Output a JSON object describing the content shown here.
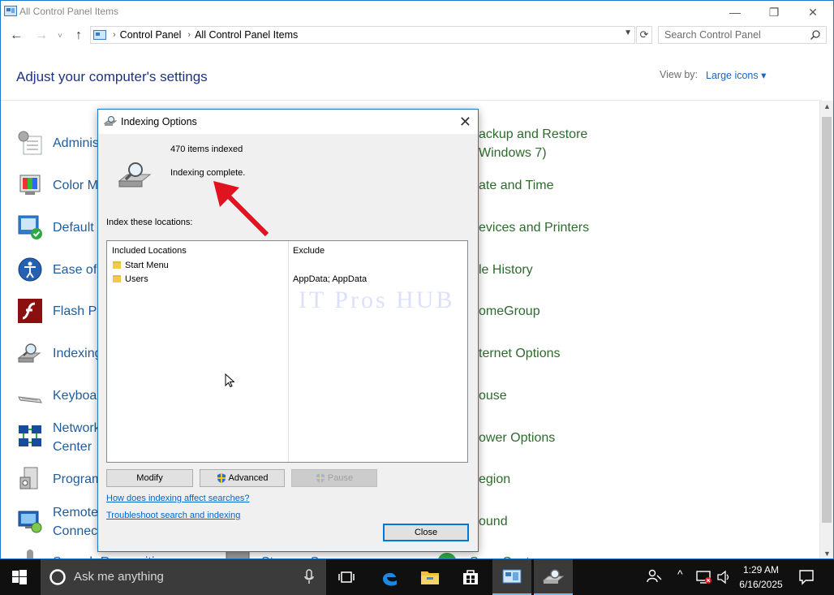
{
  "window": {
    "title": "All Control Panel Items",
    "minimize": "—",
    "maximize": "❐",
    "close": "✕"
  },
  "nav": {
    "back": "←",
    "forward": "→",
    "up": "↑",
    "breadcrumb": [
      "Control Panel",
      "All Control Panel Items"
    ],
    "search_placeholder": "Search Control Panel"
  },
  "header": {
    "title": "Adjust your computer's settings",
    "view_by_label": "View by:",
    "view_by_value": "Large icons ▾"
  },
  "items_left": [
    {
      "label": "Adminis",
      "icon": "administrative-tools-icon"
    },
    {
      "label": "Color M",
      "icon": "color-management-icon"
    },
    {
      "label": "Default",
      "icon": "default-programs-icon"
    },
    {
      "label": "Ease of A",
      "icon": "ease-of-access-icon"
    },
    {
      "label": "Flash Pla",
      "icon": "flash-player-icon"
    },
    {
      "label": "Indexing",
      "icon": "indexing-options-icon"
    },
    {
      "label": "Keyboa",
      "icon": "keyboard-icon"
    },
    {
      "label": "Network",
      "label2": "Center",
      "icon": "network-center-icon"
    },
    {
      "label": "Program",
      "icon": "programs-icon"
    },
    {
      "label": "Remote",
      "label2": "Connect",
      "icon": "remote-connections-icon"
    },
    {
      "label": "Speech Recognition",
      "icon": "speech-recognition-icon"
    }
  ],
  "items_mid_bottom": {
    "label": "Storage Spaces"
  },
  "items_right": [
    {
      "label": "ackup and Restore",
      "label2": "Windows 7)"
    },
    {
      "label": "ate and Time"
    },
    {
      "label": "evices and Printers"
    },
    {
      "label": "le History"
    },
    {
      "label": "omeGroup"
    },
    {
      "label": "ternet Options"
    },
    {
      "label": "ouse"
    },
    {
      "label": "ower Options"
    },
    {
      "label": "egion"
    },
    {
      "label": "ound"
    },
    {
      "label": "Sync Center"
    }
  ],
  "dialog": {
    "title": "Indexing Options",
    "close": "✕",
    "items_indexed": "470 items indexed",
    "status": "Indexing complete.",
    "locations_label": "Index these locations:",
    "col_included": "Included Locations",
    "col_exclude": "Exclude",
    "locations": [
      {
        "name": "Start Menu",
        "exclude": ""
      },
      {
        "name": "Users",
        "exclude": "AppData; AppData"
      }
    ],
    "watermark": "IT Pros HUB",
    "buttons": {
      "modify": "Modify",
      "advanced": "Advanced",
      "pause": "Pause",
      "close": "Close"
    },
    "links": {
      "how": "How does indexing affect searches?",
      "troubleshoot": "Troubleshoot search and indexing"
    }
  },
  "taskbar": {
    "search_text": "Ask me anything",
    "time": "1:29 AM",
    "date": "6/16/2025",
    "pinned": [
      "task-view-icon",
      "edge-icon",
      "file-explorer-icon",
      "store-icon",
      "control-panel-icon",
      "indexing-options-icon"
    ]
  },
  "colors": {
    "accent": "#0078d7",
    "link": "#1a65c0",
    "heading": "#1e3287",
    "arrow": "#e0141e"
  }
}
